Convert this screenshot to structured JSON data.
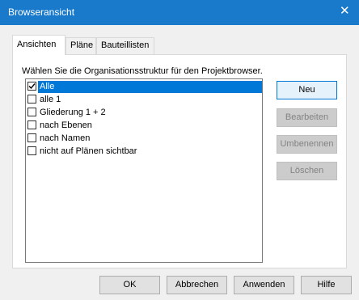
{
  "window": {
    "title": "Browseransicht",
    "close_glyph": "✕"
  },
  "tabs": [
    {
      "label": "Ansichten",
      "active": true
    },
    {
      "label": "Pläne",
      "active": false
    },
    {
      "label": "Bauteillisten",
      "active": false
    }
  ],
  "instruction": "Wählen Sie die Organisationsstruktur für den Projektbrowser.",
  "list": {
    "items": [
      {
        "label": "Alle",
        "checked": true,
        "selected": true
      },
      {
        "label": "alle 1",
        "checked": false,
        "selected": false
      },
      {
        "label": "Gliederung 1 + 2",
        "checked": false,
        "selected": false
      },
      {
        "label": "nach Ebenen",
        "checked": false,
        "selected": false
      },
      {
        "label": "nach Namen",
        "checked": false,
        "selected": false
      },
      {
        "label": "nicht auf Plänen sichtbar",
        "checked": false,
        "selected": false
      }
    ]
  },
  "side_buttons": {
    "new": "Neu",
    "edit": "Bearbeiten",
    "rename": "Umbenennen",
    "delete": "Löschen"
  },
  "footer_buttons": {
    "ok": "OK",
    "cancel": "Abbrechen",
    "apply": "Anwenden",
    "help": "Hilfe"
  },
  "colors": {
    "titlebar": "#1979ca",
    "selection": "#0078d7",
    "disabled_button": "#cccccc"
  }
}
